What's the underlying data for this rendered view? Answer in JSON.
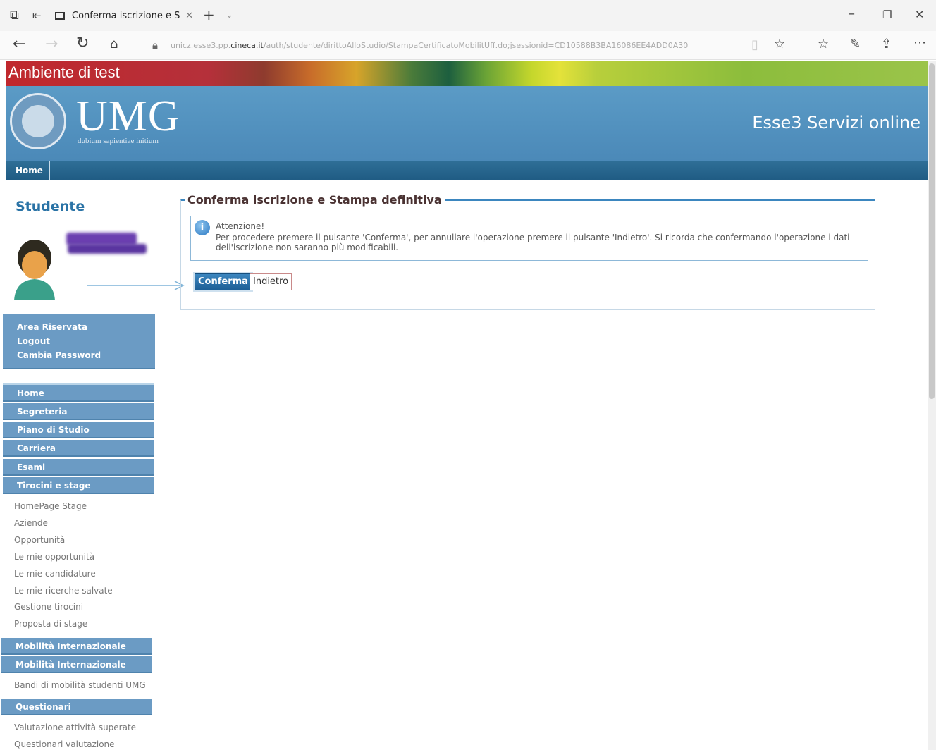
{
  "browser": {
    "tab_title": "Conferma iscrizione e S",
    "url_prefix": "unicz.esse3.pp.",
    "url_domain": "cineca.it",
    "url_path": "/auth/studente/dirittoAlloStudio/StampaCertificatoMobilitUff.do;jsessionid=CD10588B3BA16086EE4ADD0A30"
  },
  "site": {
    "test_banner": "Ambiente di test",
    "logo_text": "UMG",
    "logo_motto": "dubium sapientiae initium",
    "service_title": "Esse3 Servizi online",
    "nav_home": "Home"
  },
  "sidebar": {
    "role_title": "Studente",
    "area_links": [
      "Area Riservata",
      "Logout",
      "Cambia Password"
    ],
    "menu": {
      "home": "Home",
      "segreteria": "Segreteria",
      "piano": "Piano di Studio",
      "carriera": "Carriera",
      "esami": "Esami",
      "tirocini": "Tirocini e stage",
      "tirocini_items": [
        "HomePage Stage",
        "Aziende",
        "Opportunità",
        "Le mie opportunità",
        "Le mie candidature",
        "Le mie ricerche salvate",
        "Gestione tirocini",
        "Proposta di stage"
      ],
      "mobilita1": "Mobilità Internazionale",
      "mobilita2": "Mobilità Internazionale",
      "mobilita_items": [
        "Bandi di mobilità studenti UMG"
      ],
      "questionari": "Questionari",
      "questionari_items": [
        "Valutazione attività superate",
        "Questionari valutazione"
      ]
    }
  },
  "main": {
    "legend": "Conferma iscrizione e Stampa definitiva",
    "alert_title": "Attenzione!",
    "alert_text": "Per procedere premere il pulsante 'Conferma', per annullare l'operazione premere il pulsante 'Indietro'. Si ricorda che confermando l'operazione i dati dell'iscrizione non saranno più modificabili.",
    "confirm_label": "Conferma",
    "back_label": "Indietro"
  },
  "colors": {
    "accent": "#4a8ab9",
    "menu": "#6b9bc4",
    "title": "#2a73a6"
  }
}
